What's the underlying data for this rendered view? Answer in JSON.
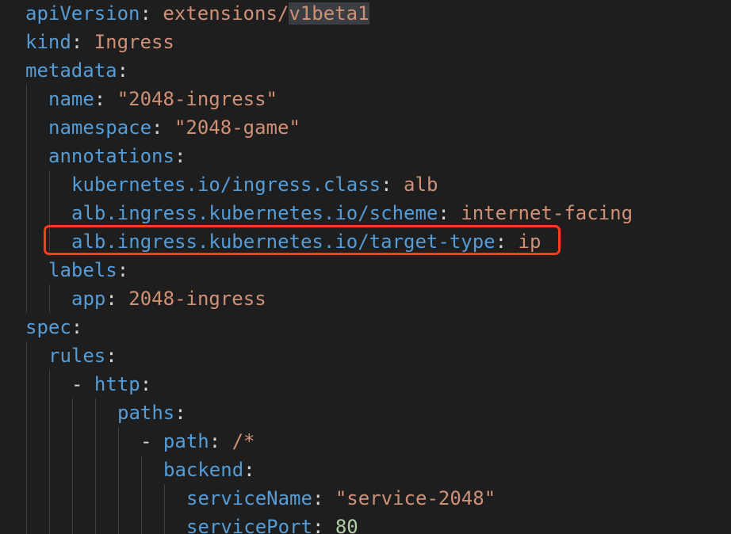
{
  "lines": [
    {
      "indent": 0,
      "key": "apiVersion",
      "sep": ": ",
      "value": "extensions/",
      "value_hl": "v1beta1",
      "value_type": "str"
    },
    {
      "indent": 0,
      "key": "kind",
      "sep": ": ",
      "value": "Ingress",
      "value_type": "str"
    },
    {
      "indent": 0,
      "key": "metadata",
      "sep": ":",
      "value": "",
      "value_type": "none"
    },
    {
      "indent": 1,
      "key": "name",
      "sep": ": ",
      "value": "\"2048-ingress\"",
      "value_type": "str"
    },
    {
      "indent": 1,
      "key": "namespace",
      "sep": ": ",
      "value": "\"2048-game\"",
      "value_type": "str"
    },
    {
      "indent": 1,
      "key": "annotations",
      "sep": ":",
      "value": "",
      "value_type": "none"
    },
    {
      "indent": 2,
      "key": "kubernetes.io/ingress.class",
      "sep": ": ",
      "value": "alb",
      "value_type": "str"
    },
    {
      "indent": 2,
      "key": "alb.ingress.kubernetes.io/scheme",
      "sep": ": ",
      "value": "internet-facing",
      "value_type": "str"
    },
    {
      "indent": 2,
      "key": "alb.ingress.kubernetes.io/target-type",
      "sep": ": ",
      "value": "ip",
      "value_type": "str"
    },
    {
      "indent": 1,
      "key": "labels",
      "sep": ":",
      "value": "",
      "value_type": "none"
    },
    {
      "indent": 2,
      "key": "app",
      "sep": ": ",
      "value": "2048-ingress",
      "value_type": "str"
    },
    {
      "indent": 0,
      "key": "spec",
      "sep": ":",
      "value": "",
      "value_type": "none"
    },
    {
      "indent": 1,
      "key": "rules",
      "sep": ":",
      "value": "",
      "value_type": "none"
    },
    {
      "indent": 2,
      "dash": "- ",
      "key": "http",
      "sep": ":",
      "value": "",
      "value_type": "none"
    },
    {
      "indent": 4,
      "key": "paths",
      "sep": ":",
      "value": "",
      "value_type": "none"
    },
    {
      "indent": 5,
      "dash": "- ",
      "key": "path",
      "sep": ": ",
      "value": "/*",
      "value_type": "str"
    },
    {
      "indent": 6,
      "key": "backend",
      "sep": ":",
      "value": "",
      "value_type": "none"
    },
    {
      "indent": 7,
      "key": "serviceName",
      "sep": ": ",
      "value": "\"service-2048\"",
      "value_type": "str"
    },
    {
      "indent": 7,
      "key": "servicePort",
      "sep": ": ",
      "value": "80",
      "value_type": "num"
    }
  ],
  "highlighted_line": 8,
  "colors": {
    "background": "#1e1e1e",
    "key": "#569cd6",
    "string": "#ce9178",
    "number": "#b5cea8",
    "punctuation": "#d4d4d4",
    "highlight_box": "#ff3b1f",
    "indent_guide": "#404040"
  }
}
